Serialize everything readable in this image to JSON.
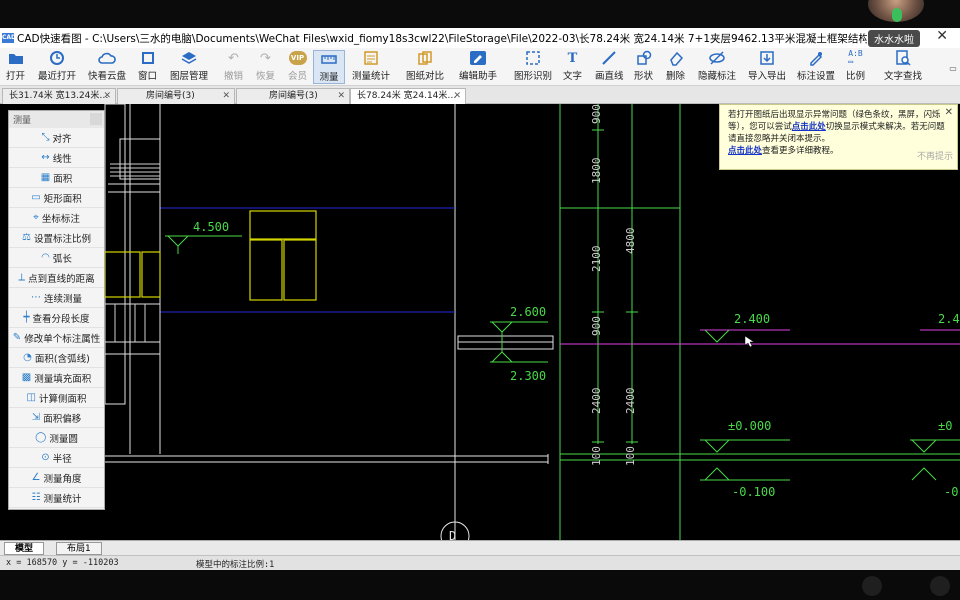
{
  "window": {
    "title": "CAD快速看图 - C:\\Users\\三水的电脑\\Documents\\WeChat Files\\wxid_fiomy18s3cwl22\\FileStorage\\File\\2022-03\\长78.24米 宽24.14米 7+1夹层9462.13平米混凝土框架结构就业培训办公楼建施【平立剖 ...",
    "app_icon": "CAD",
    "user_badge": "水水水啦",
    "close": "✕"
  },
  "toolbar": {
    "open": "打开",
    "recent": "最近打开",
    "cloud": "快看云盘",
    "window": "窗口",
    "layers": "图层管理",
    "undo": "撤销",
    "redo": "恢复",
    "member": "会员",
    "vip": "VIP",
    "measure": "测量",
    "measure_stats": "测量统计",
    "compare": "图纸对比",
    "edit_helper": "编辑助手",
    "shape_recog": "图形识别",
    "text": "文字",
    "draw_line": "画直线",
    "shape": "形状",
    "delete": "删除",
    "hide_marks": "隐藏标注",
    "import_export": "导入导出",
    "mark_settings": "标注设置",
    "scale": "比例",
    "text_search": "文字查找"
  },
  "tabs": [
    {
      "label": "长31.74米 宽13.24米…",
      "close": "✕"
    },
    {
      "label": "房间编号(3)",
      "close": "✕"
    },
    {
      "label": "房间编号(3)",
      "close": "✕"
    },
    {
      "label": "长78.24米 宽24.14米…",
      "close": "✕"
    }
  ],
  "panel": {
    "title": "测量",
    "items": [
      {
        "label": "对齐",
        "icon": "align-icon"
      },
      {
        "label": "线性",
        "icon": "linear-icon"
      },
      {
        "label": "面积",
        "icon": "area-icon"
      },
      {
        "label": "矩形面积",
        "icon": "rect-area-icon"
      },
      {
        "label": "坐标标注",
        "icon": "coordinate-icon"
      },
      {
        "label": "设置标注比例",
        "icon": "scale-icon"
      },
      {
        "label": "弧长",
        "icon": "arc-icon"
      },
      {
        "label": "点到直线的距离",
        "icon": "point-line-icon"
      },
      {
        "label": "连续测量",
        "icon": "continuous-icon"
      },
      {
        "label": "查看分段长度",
        "icon": "segment-icon"
      },
      {
        "label": "修改单个标注属性",
        "icon": "edit-mark-icon"
      },
      {
        "label": "面积(含弧线)",
        "icon": "arc-area-icon"
      },
      {
        "label": "测量填充面积",
        "icon": "fill-area-icon"
      },
      {
        "label": "计算侧面积",
        "icon": "side-area-icon"
      },
      {
        "label": "面积偏移",
        "icon": "offset-icon"
      },
      {
        "label": "测量圆",
        "icon": "circle-icon"
      },
      {
        "label": "半径",
        "icon": "radius-icon"
      },
      {
        "label": "测量角度",
        "icon": "angle-icon"
      },
      {
        "label": "测量统计",
        "icon": "stats-icon"
      }
    ]
  },
  "notice": {
    "line1": "若打开图纸后出现显示异常问题（绿色条纹，黑屏，闪烁等），您可以尝试",
    "link1": "点击此处",
    "line2": "切换显示模式来解决。若无问题请直接忽略并关闭本提示。",
    "link2": "点击此处",
    "line3": "查看更多详细教程。",
    "dismiss": "不再提示",
    "close": "✕"
  },
  "drawing": {
    "labels": {
      "elev_4500": "4.500",
      "elev_2600": "2.600",
      "elev_2300": "2.300",
      "elev_2400": "2.400",
      "elev_2400b": "2.4",
      "elev_0000": "±0.000",
      "elev_0000b": "±0",
      "elev_neg0100": "-0.100",
      "elev_neg0b": "-0",
      "dim_900a": "900",
      "dim_1800": "1800",
      "dim_4800": "4800",
      "dim_2100": "2100",
      "dim_900b": "900",
      "dim_2400a": "2400",
      "dim_2400b": "2400",
      "dim_100a": "100",
      "dim_100b": "100",
      "axis_d": "D"
    }
  },
  "bottom": {
    "model_tab": "模型",
    "layout_tab": "布局1"
  },
  "status": {
    "coords": "x = 168570  y = -110203",
    "scale_text": "模型中的标注比例:1"
  }
}
